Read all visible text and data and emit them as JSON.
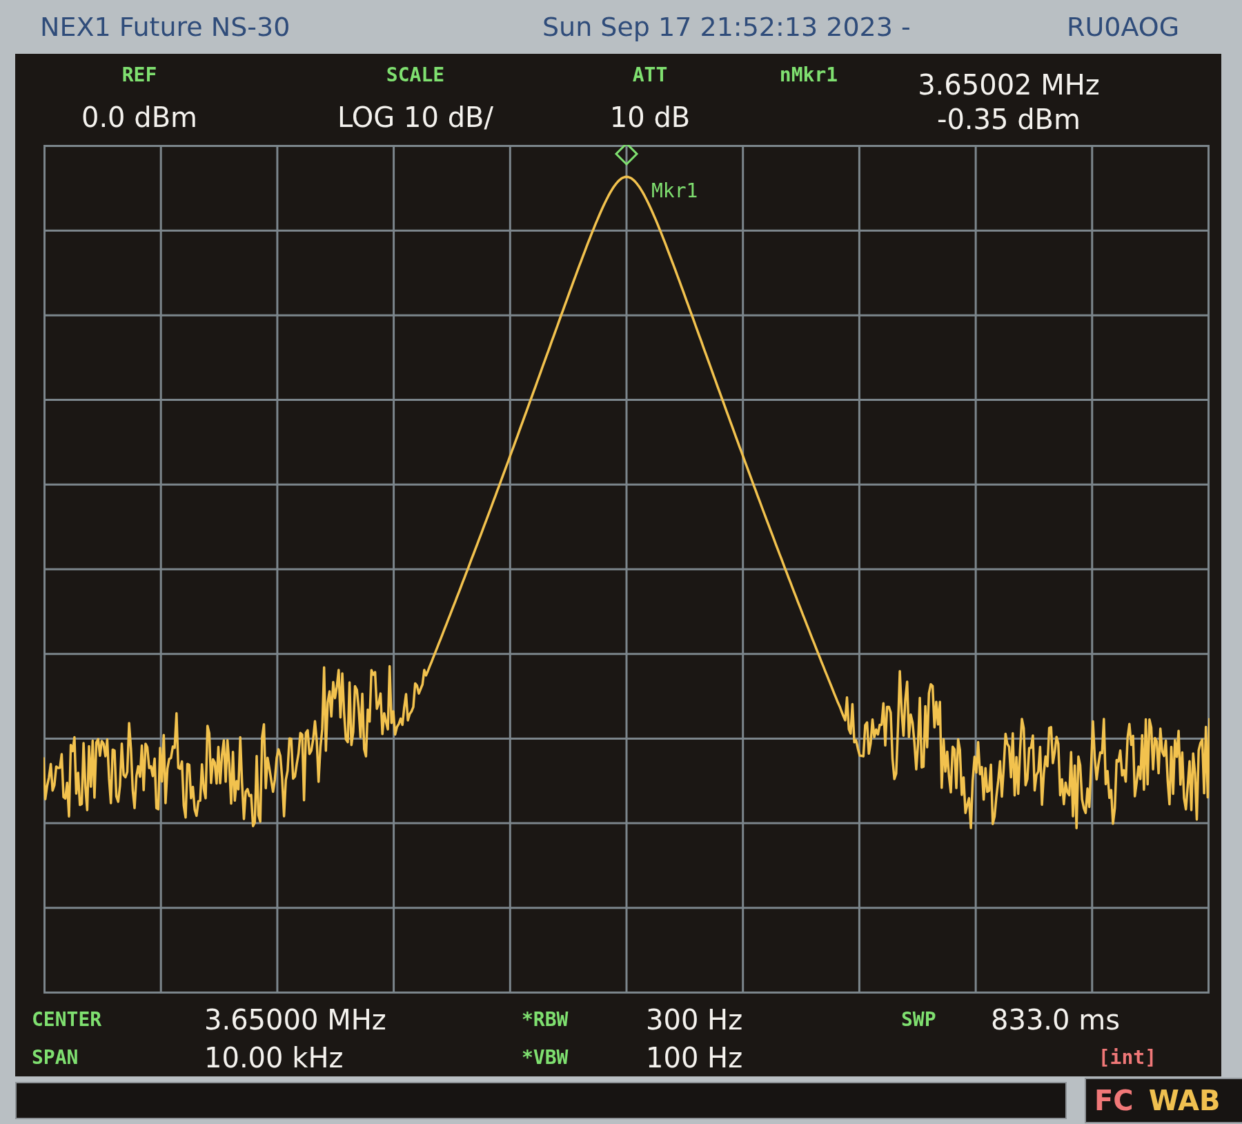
{
  "title_bar": {
    "instrument": "NEX1 Future NS-30",
    "timestamp": "Sun Sep 17 21:52:13 2023 -",
    "callsign": "RU0AOG"
  },
  "header": [
    {
      "label": "REF",
      "value": "0.0 dBm"
    },
    {
      "label": "SCALE",
      "value": "LOG 10 dB/"
    },
    {
      "label": "ATT",
      "value": "10 dB"
    },
    {
      "label": "nMkr1"
    }
  ],
  "marker_readout": {
    "frequency": "3.65002 MHz",
    "level": "-0.35 dBm"
  },
  "plot": {
    "marker_label": "Mkr1"
  },
  "footer": [
    [
      {
        "label": "CENTER",
        "value": "3.65000 MHz"
      },
      {
        "label": "*RBW",
        "value": "300 Hz"
      },
      {
        "label": "SWP",
        "value": "833.0 ms"
      }
    ],
    [
      {
        "label": "SPAN",
        "value": "10.00 kHz"
      },
      {
        "label": "*VBW",
        "value": "100 Hz"
      },
      {
        "note": "[int]"
      }
    ]
  ],
  "status_bar": {
    "codes": [
      {
        "text": "FC",
        "color": "#f07878"
      },
      {
        "text": "WAB",
        "color": "#f0c050"
      }
    ]
  }
}
